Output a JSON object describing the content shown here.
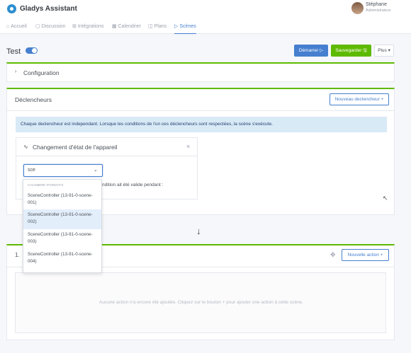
{
  "header": {
    "brand": "Gladys Assistant",
    "user_name": "Stéphane",
    "user_role": "Administrateur"
  },
  "nav": {
    "items": [
      {
        "label": "Accueil",
        "icon": "home-icon",
        "glyph": "⌂"
      },
      {
        "label": "Discussion",
        "icon": "chat-icon",
        "glyph": "▢"
      },
      {
        "label": "Intégrations",
        "icon": "grid-icon",
        "glyph": "⊞"
      },
      {
        "label": "Calendrier",
        "icon": "calendar-icon",
        "glyph": "▦"
      },
      {
        "label": "Plans",
        "icon": "map-icon",
        "glyph": "◫"
      },
      {
        "label": "Scènes",
        "icon": "play-icon",
        "glyph": "▷"
      }
    ],
    "active": "Scènes"
  },
  "scene": {
    "title": "Test",
    "enabled": true,
    "start_label": "Démarrer ▷",
    "save_label": "Sauvegarder 🖫",
    "more_label": "Plus ▾"
  },
  "config": {
    "chevron": "›",
    "title": "Configuration"
  },
  "triggers": {
    "title": "Déclencheurs",
    "new_label": "Nouveau declencheur +",
    "info": "Chaque declencheur est independant. Lorsque les conditions de l'un ces déclencheurs sont respectées, la scène s'exécute.",
    "card": {
      "icon_glyph": "∿",
      "title": "Changement d'état de l'appareil",
      "close": "×",
      "select_value": "sce",
      "select_arrow": "⌄",
      "condition_suffix": "ndition ait été valide pendant :"
    }
  },
  "dropdown": {
    "group": "CHAMBRE PARENTS",
    "options": [
      "SceneController (13-91-0-scene-001)",
      "SceneController (13-91-0-scene-002)",
      "SceneController (13-91-0-scene-003)",
      "SceneController (13-91-0-scene-004)"
    ],
    "selected_index": 1
  },
  "arrow": "↓",
  "actions": {
    "number": "1.",
    "move_glyph": "✥",
    "new_label": "Nouvelle action +",
    "empty": "Aucune action n'a encore été ajoutée. Cliquez sur le bouton + pour ajouter une action à cette scène."
  },
  "colors": {
    "primary": "#467fcf",
    "success": "#5eba00",
    "info_bg": "#d9eaf7"
  }
}
